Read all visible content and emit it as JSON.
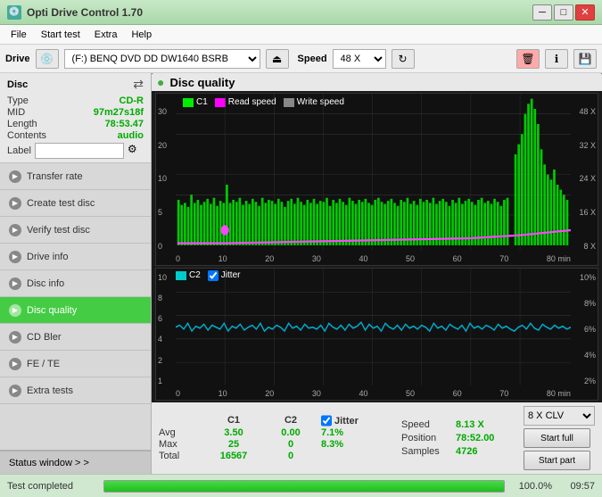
{
  "titlebar": {
    "title": "Opti Drive Control 1.70",
    "icon": "💿"
  },
  "menubar": {
    "items": [
      "File",
      "Start test",
      "Extra",
      "Help"
    ]
  },
  "drivebar": {
    "drive_label": "Drive",
    "drive_value": "(F:)  BENQ DVD DD DW1640 BSRB",
    "speed_label": "Speed",
    "speed_value": "48 X"
  },
  "disc": {
    "title": "Disc",
    "type_label": "Type",
    "type_value": "CD-R",
    "mid_label": "MID",
    "mid_value": "97m27s18f",
    "length_label": "Length",
    "length_value": "78:53.47",
    "contents_label": "Contents",
    "contents_value": "audio",
    "label_label": "Label",
    "label_value": ""
  },
  "nav": {
    "items": [
      {
        "id": "transfer-rate",
        "label": "Transfer rate",
        "active": false
      },
      {
        "id": "create-test-disc",
        "label": "Create test disc",
        "active": false
      },
      {
        "id": "verify-test-disc",
        "label": "Verify test disc",
        "active": false
      },
      {
        "id": "drive-info",
        "label": "Drive info",
        "active": false
      },
      {
        "id": "disc-info",
        "label": "Disc info",
        "active": false
      },
      {
        "id": "disc-quality",
        "label": "Disc quality",
        "active": true
      },
      {
        "id": "cd-bler",
        "label": "CD Bler",
        "active": false
      },
      {
        "id": "fe-te",
        "label": "FE / TE",
        "active": false
      },
      {
        "id": "extra-tests",
        "label": "Extra tests",
        "active": false
      }
    ],
    "status_window": "Status window > >"
  },
  "chart": {
    "title": "Disc quality",
    "top": {
      "legend": [
        {
          "id": "c1",
          "label": "C1",
          "color": "#00ff00"
        },
        {
          "id": "read-speed",
          "label": "Read speed",
          "color": "#ff00ff"
        },
        {
          "id": "write-speed",
          "label": "Write speed",
          "color": "#aaaaaa"
        }
      ],
      "y_left": [
        "30",
        "20",
        "10",
        "5",
        "0"
      ],
      "y_right": [
        "48 X",
        "32 X",
        "24 X",
        "16 X",
        "8 X"
      ],
      "x_labels": [
        "0",
        "10",
        "20",
        "30",
        "40",
        "50",
        "60",
        "70",
        "80 min"
      ]
    },
    "bottom": {
      "legend": [
        {
          "id": "c2",
          "label": "C2",
          "color": "#00cccc"
        },
        {
          "id": "jitter",
          "label": "Jitter",
          "color": "#aaaaaa"
        }
      ],
      "y_left": [
        "10",
        "8",
        "6",
        "4",
        "2",
        "1"
      ],
      "y_right": [
        "10%",
        "8%",
        "6%",
        "4%",
        "2%"
      ],
      "x_labels": [
        "0",
        "10",
        "20",
        "30",
        "40",
        "50",
        "60",
        "70",
        "80 min"
      ]
    }
  },
  "stats": {
    "c1_label": "C1",
    "c2_label": "C2",
    "jitter_label": "Jitter",
    "avg_label": "Avg",
    "avg_c1": "3.50",
    "avg_c2": "0.00",
    "avg_jitter": "7.1%",
    "max_label": "Max",
    "max_c1": "25",
    "max_c2": "0",
    "max_jitter": "8.3%",
    "total_label": "Total",
    "total_c1": "16567",
    "total_c2": "0",
    "speed_label": "Speed",
    "speed_value": "8.13 X",
    "position_label": "Position",
    "position_value": "78:52.00",
    "samples_label": "Samples",
    "samples_value": "4726",
    "clv_option": "8 X CLV",
    "btn_start_full": "Start full",
    "btn_start_part": "Start part"
  },
  "statusbar": {
    "text": "Test completed",
    "progress": "100.0%",
    "progress_value": 100,
    "time": "09:57"
  }
}
